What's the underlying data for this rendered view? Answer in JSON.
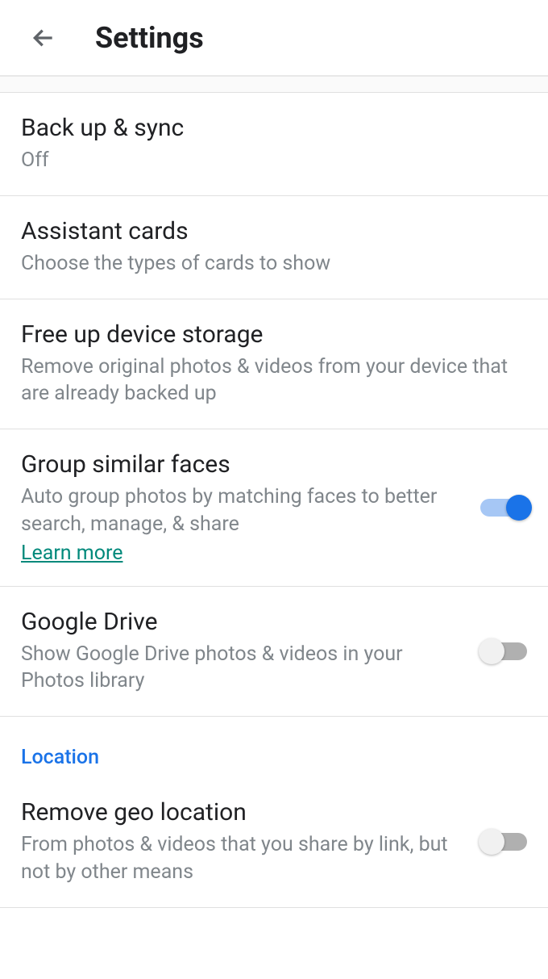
{
  "header": {
    "title": "Settings"
  },
  "rows": {
    "backup": {
      "title": "Back up & sync",
      "sub": "Off"
    },
    "assistant": {
      "title": "Assistant cards",
      "sub": "Choose the types of cards to show"
    },
    "freeup": {
      "title": "Free up device storage",
      "sub": "Remove original photos & videos from your device that are already backed up"
    },
    "faces": {
      "title": "Group similar faces",
      "sub": "Auto group photos by matching faces to better search, manage, & share",
      "link": "Learn more"
    },
    "drive": {
      "title": "Google Drive",
      "sub": "Show Google Drive photos & videos in your Photos library"
    },
    "geo": {
      "title": "Remove geo location",
      "sub": "From photos & videos that you share by link, but not by other means"
    }
  },
  "sections": {
    "location": "Location"
  }
}
